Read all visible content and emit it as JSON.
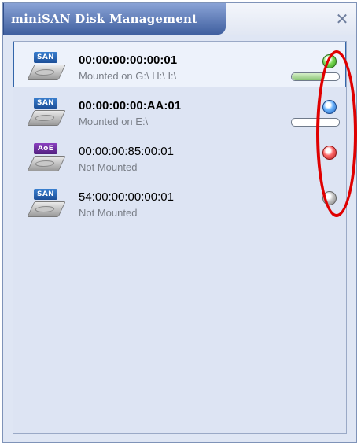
{
  "window": {
    "title": "miniSAN Disk Management",
    "close_icon": "close-icon"
  },
  "colors": {
    "title_tab": "#4a6aa8",
    "panel_bg": "#dde4f3",
    "selection_border": "#3366aa",
    "annotation": "#e00000"
  },
  "items": [
    {
      "name": "00:00:00:00:00:01",
      "status": "Mounted on G:\\ H:\\ I:\\",
      "badge": "SAN",
      "led": "green",
      "bold": true,
      "selected": true,
      "progress": 0.7
    },
    {
      "name": "00:00:00:00:AA:01",
      "status": "Mounted on E:\\",
      "badge": "SAN",
      "led": "blue",
      "bold": true,
      "selected": false,
      "progress": 0.0
    },
    {
      "name": "00:00:00:85:00:01",
      "status": "Not Mounted",
      "badge": "AoE",
      "led": "red",
      "bold": false,
      "selected": false,
      "progress": null
    },
    {
      "name": "54:00:00:00:00:01",
      "status": "Not Mounted",
      "badge": "SAN",
      "led": "gray",
      "bold": false,
      "selected": false,
      "progress": null
    }
  ]
}
